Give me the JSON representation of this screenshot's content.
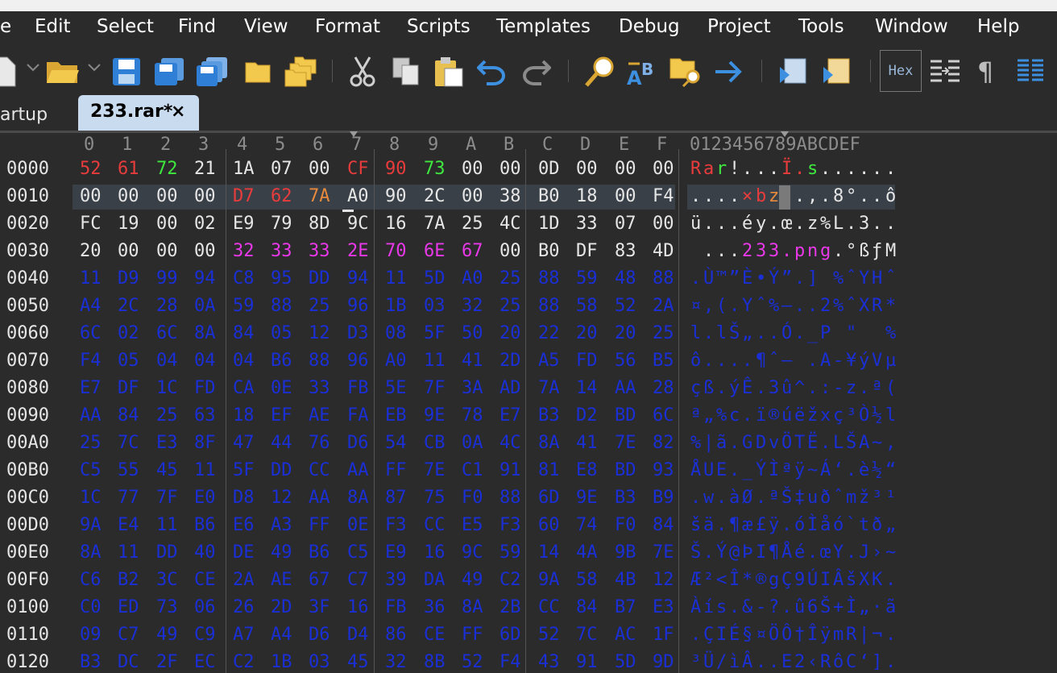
{
  "menu": [
    "e",
    "Edit",
    "Select",
    "Find",
    "View",
    "Format",
    "Scripts",
    "Templates",
    "Debug",
    "Project",
    "Tools",
    "Window",
    "Help"
  ],
  "toolbar": {
    "hex_label": "Hex",
    "pilcrow": "¶",
    "icons": [
      "new-file-icon",
      "open-folder-icon",
      "save-icon",
      "save-as-icon",
      "save-all-icon",
      "folder-icon",
      "folders-icon",
      "cut-icon",
      "copy-icon",
      "paste-icon",
      "undo-icon",
      "redo-icon",
      "find-icon",
      "replace-icon",
      "find-in-files-icon",
      "goto-icon",
      "run-script-icon",
      "run-template-icon",
      "hex-mode-icon",
      "columns-icon",
      "pilcrow-icon",
      "view-icon"
    ]
  },
  "tabs": {
    "inactive": "artup",
    "active": "233.rar*",
    "close": "×"
  },
  "hex": {
    "column_headers": [
      "0",
      "1",
      "2",
      "3",
      "4",
      "5",
      "6",
      "7",
      "8",
      "9",
      "A",
      "B",
      "C",
      "D",
      "E",
      "F"
    ],
    "ascii_header": "0123456789ABCDEF",
    "colors": {
      "default": "#e6e6e6",
      "data_blue": "#1a2fd6",
      "red": "#e83c3c",
      "green": "#3ee83e",
      "orange": "#e88a3c",
      "magenta": "#e838e8"
    },
    "rows": [
      {
        "addr": "0000",
        "bytes": [
          "52",
          "61",
          "72",
          "21",
          "1A",
          "07",
          "00",
          "CF",
          "90",
          "73",
          "00",
          "00",
          "0D",
          "00",
          "00",
          "00"
        ],
        "ascii": "Rar!...Ï.s......",
        "color": "default"
      },
      {
        "addr": "0010",
        "bytes": [
          "00",
          "00",
          "00",
          "00",
          "D7",
          "62",
          "7A",
          "A0",
          "90",
          "2C",
          "00",
          "38",
          "B0",
          "18",
          "00",
          "F4"
        ],
        "ascii": "....×bz .,.8°..ô",
        "color": "default"
      },
      {
        "addr": "0020",
        "bytes": [
          "FC",
          "19",
          "00",
          "02",
          "E9",
          "79",
          "8D",
          "9C",
          "16",
          "7A",
          "25",
          "4C",
          "1D",
          "33",
          "07",
          "00"
        ],
        "ascii": "ü...éy.œ.z%L.3..",
        "color": "default"
      },
      {
        "addr": "0030",
        "bytes": [
          "20",
          "00",
          "00",
          "00",
          "32",
          "33",
          "33",
          "2E",
          "70",
          "6E",
          "67",
          "00",
          "B0",
          "DF",
          "83",
          "4D"
        ],
        "ascii": " ...233.png.°ßƒM",
        "color": "default"
      },
      {
        "addr": "0040",
        "bytes": [
          "11",
          "D9",
          "99",
          "94",
          "C8",
          "95",
          "DD",
          "94",
          "11",
          "5D",
          "A0",
          "25",
          "88",
          "59",
          "48",
          "88"
        ],
        "ascii": ".Ù™”È•Ý”.] %ˆYHˆ",
        "color": "data_blue"
      },
      {
        "addr": "0050",
        "bytes": [
          "A4",
          "2C",
          "28",
          "0A",
          "59",
          "88",
          "25",
          "96",
          "1B",
          "03",
          "32",
          "25",
          "88",
          "58",
          "52",
          "2A"
        ],
        "ascii": "¤,(.Yˆ%–..2%ˆXR*",
        "color": "data_blue"
      },
      {
        "addr": "0060",
        "bytes": [
          "6C",
          "02",
          "6C",
          "8A",
          "84",
          "05",
          "12",
          "D3",
          "08",
          "5F",
          "50",
          "20",
          "22",
          "20",
          "20",
          "25"
        ],
        "ascii": "l.lŠ„..Ó._P \"  %",
        "color": "data_blue"
      },
      {
        "addr": "0070",
        "bytes": [
          "F4",
          "05",
          "04",
          "04",
          "04",
          "B6",
          "88",
          "96",
          "A0",
          "11",
          "41",
          "2D",
          "A5",
          "FD",
          "56",
          "B5"
        ],
        "ascii": "ô....¶ˆ– .A-¥ýVµ",
        "color": "data_blue"
      },
      {
        "addr": "0080",
        "bytes": [
          "E7",
          "DF",
          "1C",
          "FD",
          "CA",
          "0E",
          "33",
          "FB",
          "5E",
          "7F",
          "3A",
          "AD",
          "7A",
          "14",
          "AA",
          "28"
        ],
        "ascii": "çß.ýÊ.3û^.:-z.ª(",
        "color": "data_blue"
      },
      {
        "addr": "0090",
        "bytes": [
          "AA",
          "84",
          "25",
          "63",
          "18",
          "EF",
          "AE",
          "FA",
          "EB",
          "9E",
          "78",
          "E7",
          "B3",
          "D2",
          "BD",
          "6C"
        ],
        "ascii": "ª„%c.ï®úëžxç³Ò½l",
        "color": "data_blue"
      },
      {
        "addr": "00A0",
        "bytes": [
          "25",
          "7C",
          "E3",
          "8F",
          "47",
          "44",
          "76",
          "D6",
          "54",
          "CB",
          "0A",
          "4C",
          "8A",
          "41",
          "7E",
          "82"
        ],
        "ascii": "%|ã.GDvÖTË.LŠA~‚",
        "color": "data_blue"
      },
      {
        "addr": "00B0",
        "bytes": [
          "C5",
          "55",
          "45",
          "11",
          "5F",
          "DD",
          "CC",
          "AA",
          "FF",
          "7E",
          "C1",
          "91",
          "81",
          "E8",
          "BD",
          "93"
        ],
        "ascii": "ÅUE._ÝÌªÿ~Á‘.è½“",
        "color": "data_blue"
      },
      {
        "addr": "00C0",
        "bytes": [
          "1C",
          "77",
          "7F",
          "E0",
          "D8",
          "12",
          "AA",
          "8A",
          "87",
          "75",
          "F0",
          "88",
          "6D",
          "9E",
          "B3",
          "B9"
        ],
        "ascii": ".w.àØ.ªŠ‡uðˆmž³¹",
        "color": "data_blue"
      },
      {
        "addr": "00D0",
        "bytes": [
          "9A",
          "E4",
          "11",
          "B6",
          "E6",
          "A3",
          "FF",
          "0E",
          "F3",
          "CC",
          "E5",
          "F3",
          "60",
          "74",
          "F0",
          "84"
        ],
        "ascii": "šä.¶æ£ÿ.óÌåó`tð„",
        "color": "data_blue"
      },
      {
        "addr": "00E0",
        "bytes": [
          "8A",
          "11",
          "DD",
          "40",
          "DE",
          "49",
          "B6",
          "C5",
          "E9",
          "16",
          "9C",
          "59",
          "14",
          "4A",
          "9B",
          "7E"
        ],
        "ascii": "Š.Ý@ÞI¶Åé.œY.J›~",
        "color": "data_blue"
      },
      {
        "addr": "00F0",
        "bytes": [
          "C6",
          "B2",
          "3C",
          "CE",
          "2A",
          "AE",
          "67",
          "C7",
          "39",
          "DA",
          "49",
          "C2",
          "9A",
          "58",
          "4B",
          "12"
        ],
        "ascii": "Æ²<Î*®gÇ9ÚIÂšXK.",
        "color": "data_blue"
      },
      {
        "addr": "0100",
        "bytes": [
          "C0",
          "ED",
          "73",
          "06",
          "26",
          "2D",
          "3F",
          "16",
          "FB",
          "36",
          "8A",
          "2B",
          "CC",
          "84",
          "B7",
          "E3"
        ],
        "ascii": "Àís.&-?.û6Š+Ì„·ã",
        "color": "data_blue"
      },
      {
        "addr": "0110",
        "bytes": [
          "09",
          "C7",
          "49",
          "C9",
          "A7",
          "A4",
          "D6",
          "D4",
          "86",
          "CE",
          "FF",
          "6D",
          "52",
          "7C",
          "AC",
          "1F"
        ],
        "ascii": ".ÇIÉ§¤ÖÔ†ÎÿmR|¬.",
        "color": "data_blue"
      },
      {
        "addr": "0120",
        "bytes": [
          "B3",
          "DC",
          "2F",
          "EC",
          "C2",
          "1B",
          "03",
          "45",
          "32",
          "8B",
          "52",
          "F4",
          "43",
          "91",
          "5D",
          "9D"
        ],
        "ascii": "³Ü/ìÂ..E2‹RôC‘].",
        "color": "data_blue"
      }
    ],
    "byte_color_overrides": {
      "0-0": "red",
      "0-1": "red",
      "0-2": "green",
      "0-7": "red",
      "0-8": "red",
      "0-9": "green",
      "1-4": "red",
      "1-5": "red",
      "1-6": "orange",
      "3-4": "magenta",
      "3-5": "magenta",
      "3-6": "magenta",
      "3-7": "magenta",
      "3-8": "magenta",
      "3-9": "magenta",
      "3-10": "magenta"
    },
    "ascii_color_overrides": {
      "0-0": "red",
      "0-1": "red",
      "0-2": "green",
      "0-7": "red",
      "0-8": "red",
      "0-9": "green",
      "1-4": "red",
      "1-5": "red",
      "1-6": "orange",
      "3-4": "magenta",
      "3-5": "magenta",
      "3-6": "magenta",
      "3-7": "magenta",
      "3-8": "magenta",
      "3-9": "magenta",
      "3-10": "magenta"
    }
  }
}
